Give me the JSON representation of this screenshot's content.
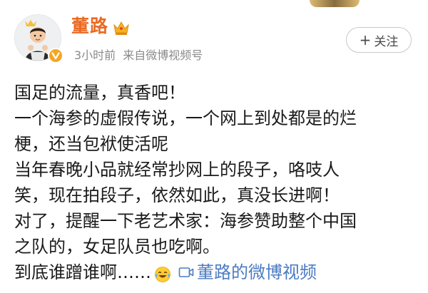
{
  "post": {
    "author": {
      "name": "董路",
      "avatar_icon": "boy-avatar",
      "verified_badge": "v",
      "member_icon": "crown-icon"
    },
    "meta": {
      "time": "3小时前",
      "source": "来自微博视频号"
    },
    "follow_label": "关注",
    "follow_plus": "+",
    "content": {
      "lines": [
        "国足的流量，真香吧！",
        "一个海参的虚假传说，一个网上到处都是的烂",
        "梗，还当包袱使活呢",
        "当年春晚小品就经常抄网上的段子，咯吱人",
        "笑，现在拍段子，依然如此，真没长进啊！",
        "对了，提醒一下老艺术家：海参赞助整个中国",
        "之队的，女足队员也吃啊。"
      ],
      "last_line_text": "到底谁蹭谁啊……",
      "emoji": "laugh-cry-emoji",
      "video_link": "董路的微博视频"
    }
  },
  "colors": {
    "username": "#ea6a22",
    "link": "#4b7bc1",
    "meta": "#8a8a8a",
    "badge": "#f5a623"
  }
}
